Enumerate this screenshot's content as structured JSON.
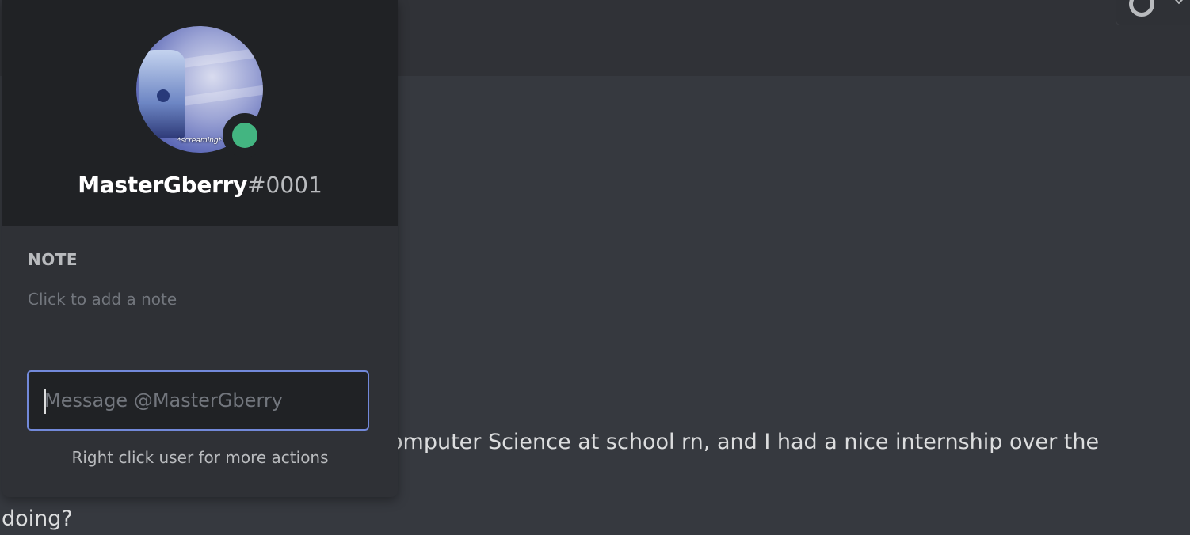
{
  "chat": {
    "line1": "omputer Science at school rn, and I had a nice internship over the",
    "line2": "doing?"
  },
  "profile": {
    "username": "MasterGberry",
    "discriminator": "#0001",
    "avatar_caption": "*screaming*",
    "status": "online",
    "status_color": "#43b581"
  },
  "note": {
    "heading": "NOTE",
    "placeholder": "Click to add a note"
  },
  "message": {
    "value": "",
    "placeholder": "Message @MasterGberry"
  },
  "hint": "Right click user for more actions",
  "top_toolbar": {
    "icon": "refresh-icon"
  }
}
